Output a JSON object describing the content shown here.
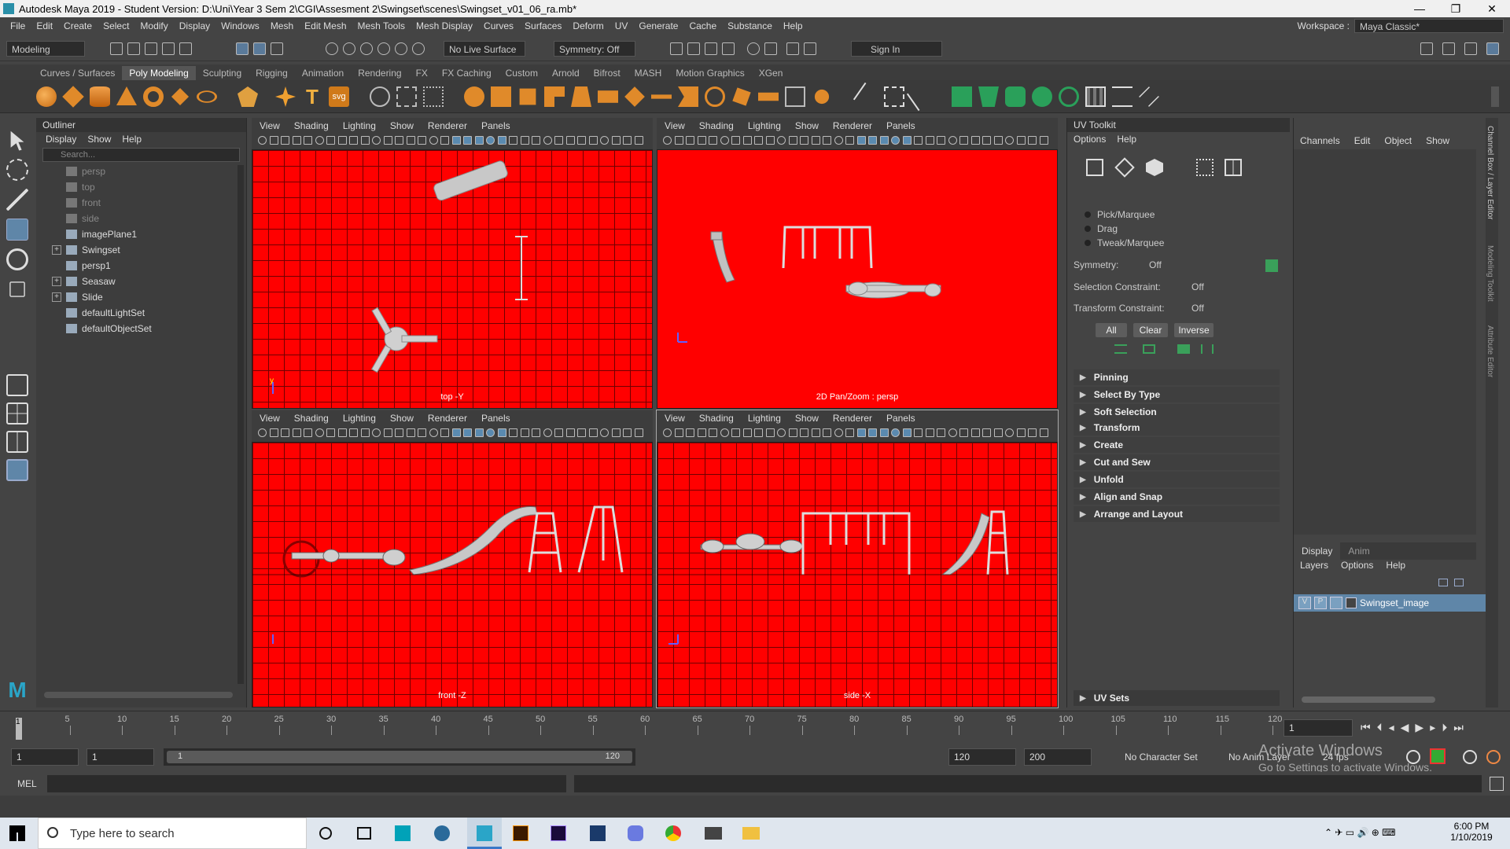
{
  "window": {
    "title": "Autodesk Maya 2019 - Student Version: D:\\Uni\\Year 3 Sem 2\\CGI\\Assesment 2\\Swingset\\scenes\\Swingset_v01_06_ra.mb*",
    "min": "—",
    "max": "❐",
    "close": "✕"
  },
  "menu": {
    "items": [
      "File",
      "Edit",
      "Create",
      "Select",
      "Modify",
      "Display",
      "Windows",
      "Mesh",
      "Edit Mesh",
      "Mesh Tools",
      "Mesh Display",
      "Curves",
      "Surfaces",
      "Deform",
      "UV",
      "Generate",
      "Cache",
      "Substance",
      "Help"
    ],
    "workspace_label": "Workspace :",
    "workspace_value": "Maya Classic*"
  },
  "status": {
    "mode": "Modeling",
    "live_surface": "No Live Surface",
    "symmetry": "Symmetry: Off",
    "sign_in": "Sign In"
  },
  "shelf": {
    "tabs": [
      "Curves / Surfaces",
      "Poly Modeling",
      "Sculpting",
      "Rigging",
      "Animation",
      "Rendering",
      "FX",
      "FX Caching",
      "Custom",
      "Arnold",
      "Bifrost",
      "MASH",
      "Motion Graphics",
      "XGen"
    ],
    "active": "Poly Modeling",
    "text_icon": "T",
    "svg_icon": "svg"
  },
  "outliner": {
    "title": "Outliner",
    "menus": [
      "Display",
      "Show",
      "Help"
    ],
    "search_placeholder": "Search...",
    "items": [
      {
        "label": "persp",
        "dim": true,
        "exp": false
      },
      {
        "label": "top",
        "dim": true,
        "exp": false
      },
      {
        "label": "front",
        "dim": true,
        "exp": false
      },
      {
        "label": "side",
        "dim": true,
        "exp": false
      },
      {
        "label": "imagePlane1",
        "dim": false,
        "exp": false
      },
      {
        "label": "Swingset",
        "dim": false,
        "exp": true
      },
      {
        "label": "persp1",
        "dim": false,
        "exp": false
      },
      {
        "label": "Seasaw",
        "dim": false,
        "exp": true
      },
      {
        "label": "Slide",
        "dim": false,
        "exp": true
      },
      {
        "label": "defaultLightSet",
        "dim": false,
        "exp": false
      },
      {
        "label": "defaultObjectSet",
        "dim": false,
        "exp": false
      }
    ]
  },
  "viewport_menu": [
    "View",
    "Shading",
    "Lighting",
    "Show",
    "Renderer",
    "Panels"
  ],
  "viewports": {
    "top": "top -Y",
    "persp": "2D Pan/Zoom : persp",
    "front": "front -Z",
    "side": "side -X",
    "axis_y": "y",
    "axis_x": "x"
  },
  "uvtoolkit": {
    "title": "UV Toolkit",
    "menus": [
      "Options",
      "Help"
    ],
    "modes": [
      "Pick/Marquee",
      "Drag",
      "Tweak/Marquee"
    ],
    "symmetry_label": "Symmetry:",
    "symmetry_value": "Off",
    "sel_label": "Selection Constraint:",
    "sel_value": "Off",
    "tr_label": "Transform Constraint:",
    "tr_value": "Off",
    "btn_all": "All",
    "btn_clear": "Clear",
    "btn_inverse": "Inverse",
    "sections1": [
      "Pinning",
      "Select By Type",
      "Soft Selection"
    ],
    "sections2": [
      "Transform",
      "Create",
      "Cut and Sew",
      "Unfold",
      "Align and Snap",
      "Arrange and Layout"
    ],
    "uv_sets": "UV Sets"
  },
  "channel": {
    "menus": [
      "Channels",
      "Edit",
      "Object",
      "Show"
    ],
    "side_tabs": [
      "Channel Box / Layer Editor",
      "Modeling Toolkit",
      "Attribute Editor"
    ],
    "tabs": [
      "Display",
      "Anim"
    ],
    "layer_menus": [
      "Layers",
      "Options",
      "Help"
    ],
    "layer_v": "V",
    "layer_p": "P",
    "layer_name": "Swingset_image"
  },
  "timeline": {
    "ticks": [
      "5",
      "10",
      "15",
      "20",
      "25",
      "30",
      "35",
      "40",
      "45",
      "50",
      "55",
      "60",
      "65",
      "70",
      "75",
      "80",
      "85",
      "90",
      "95",
      "100",
      "105",
      "110",
      "115",
      "120"
    ],
    "current": "1",
    "current_frame_field": "1"
  },
  "range": {
    "start": "1",
    "anim_start": "1",
    "slider_start": "1",
    "slider_end": "120",
    "end": "120",
    "anim_end": "200",
    "char_set": "No Character Set",
    "anim_layer": "No Anim Layer",
    "fps": "24 fps"
  },
  "cmd": {
    "label": "MEL"
  },
  "watermark": {
    "line1": "Activate Windows",
    "line2": "Go to Settings to activate Windows."
  },
  "taskbar": {
    "search": "Type here to search",
    "time": "6:00 PM",
    "date": "1/10/2019"
  }
}
